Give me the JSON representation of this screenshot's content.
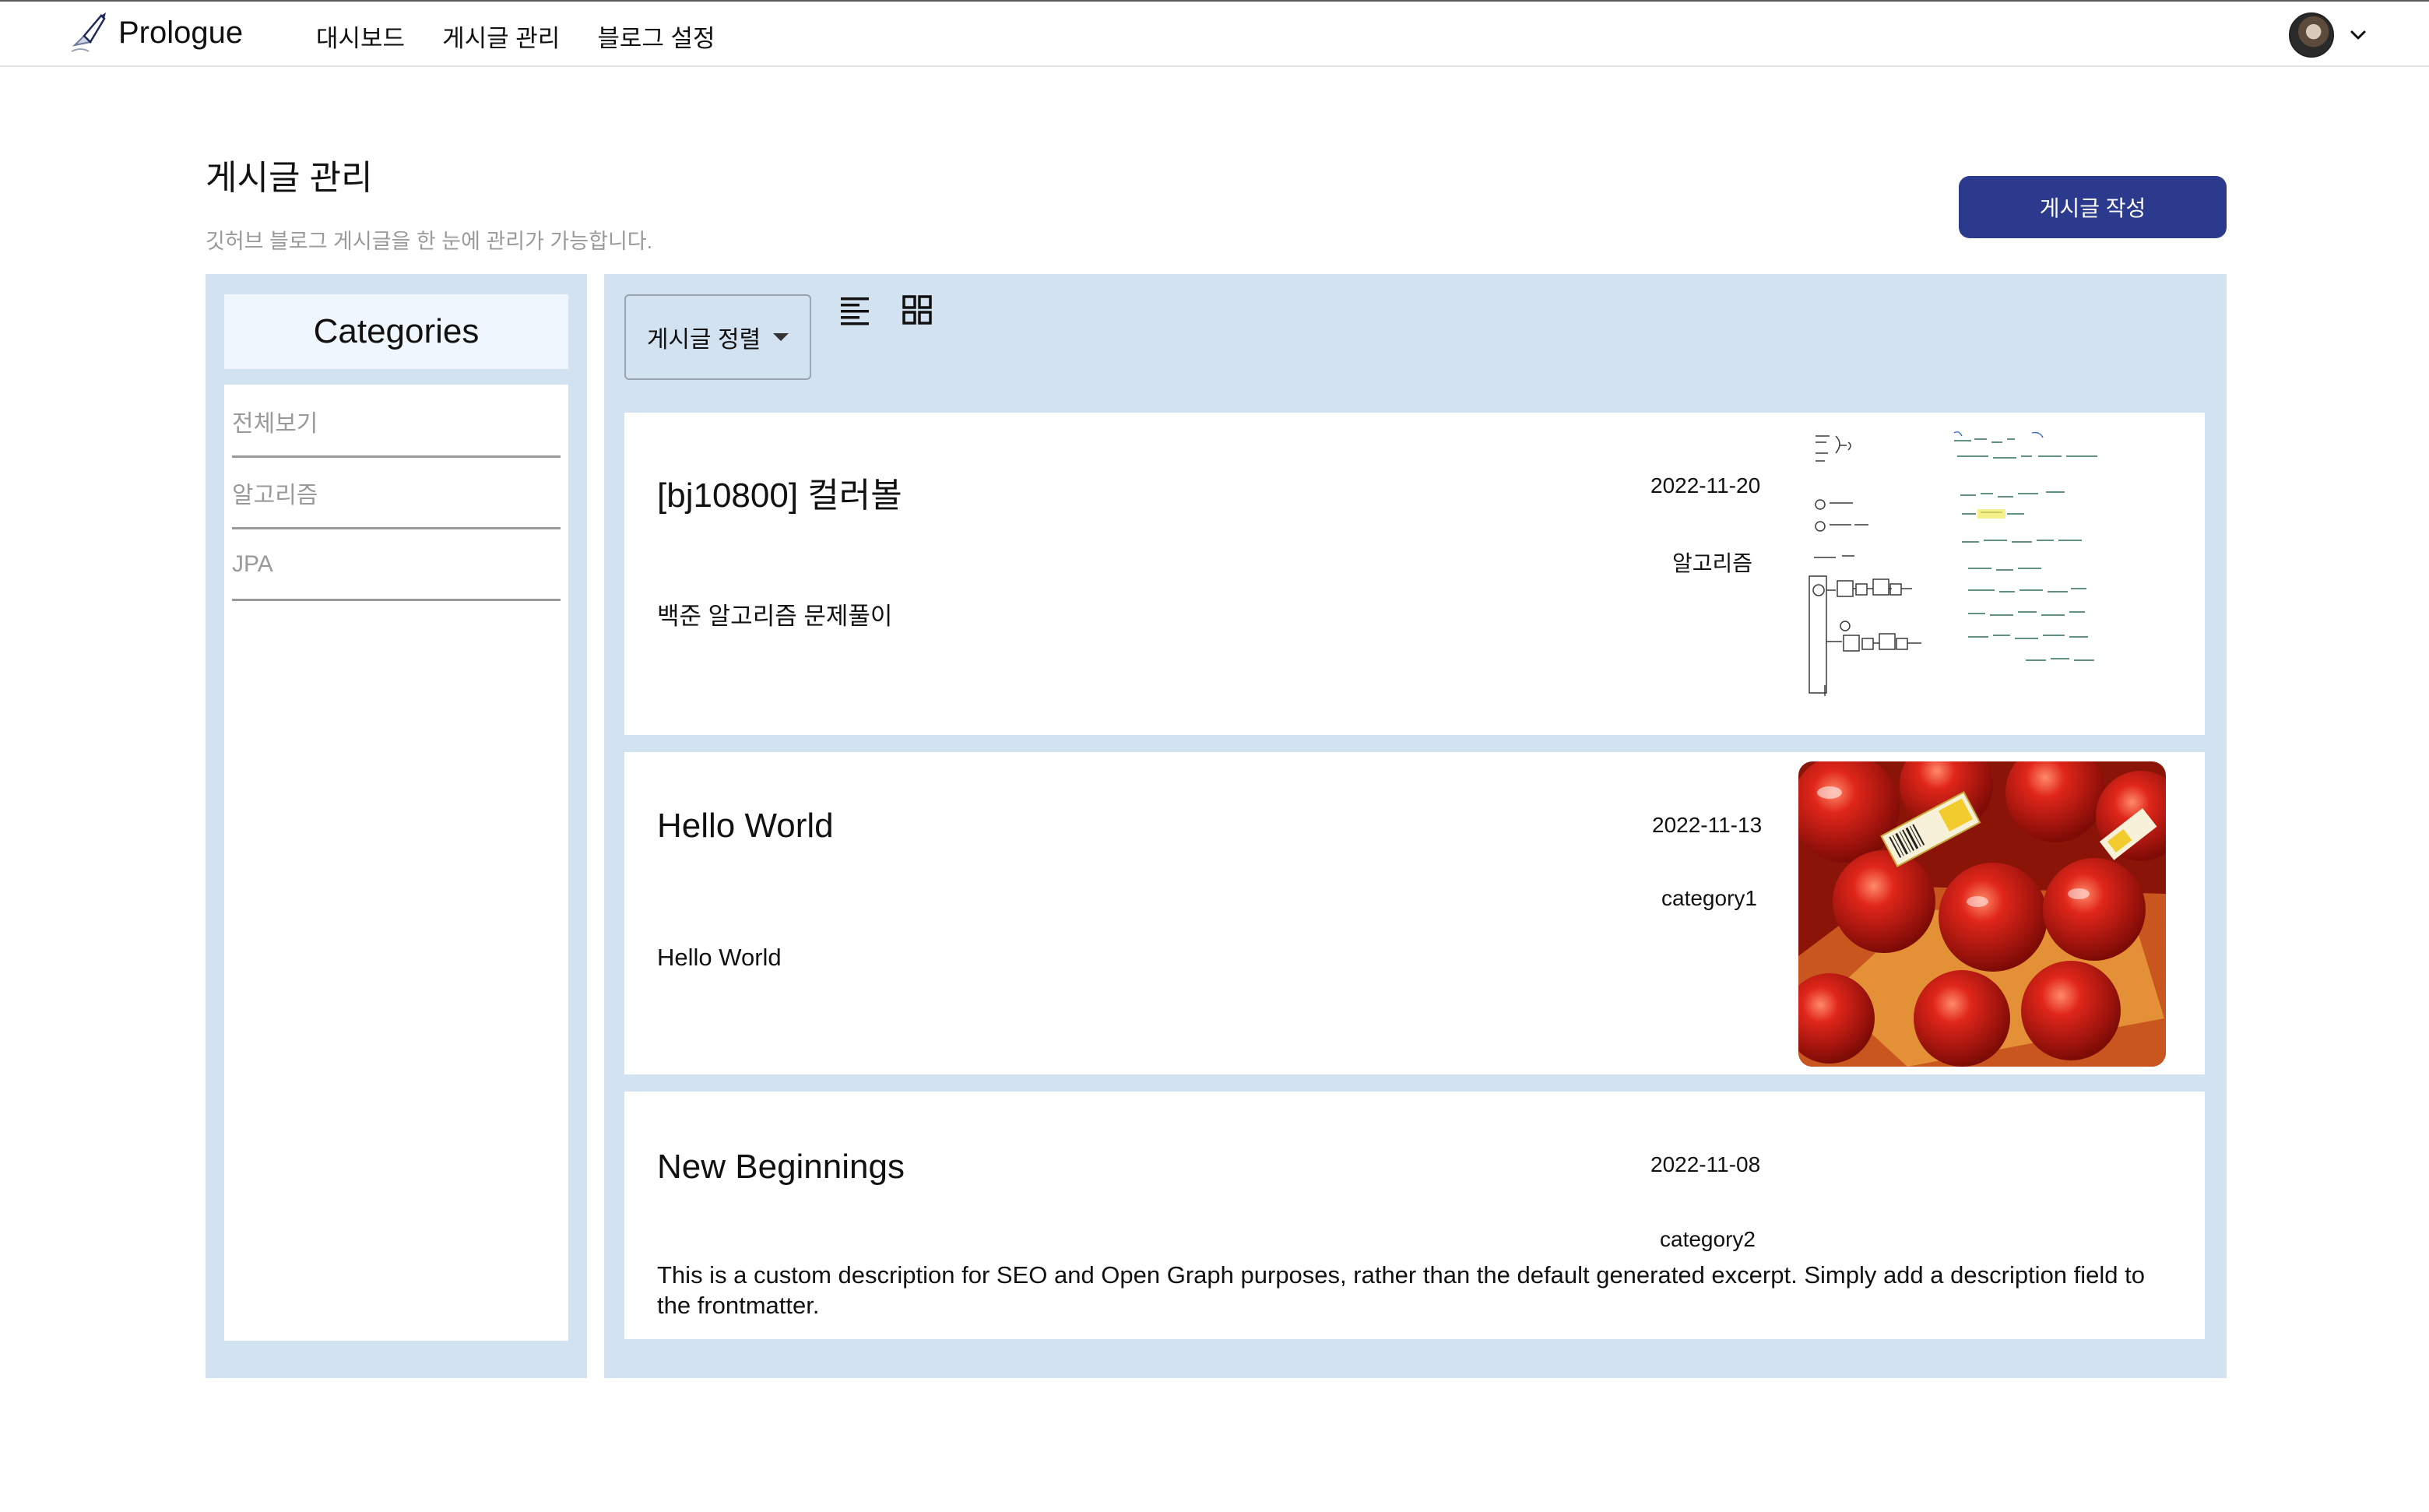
{
  "nav": {
    "brand": "Prologue",
    "items": [
      "대시보드",
      "게시글 관리",
      "블로그 설정"
    ]
  },
  "header": {
    "title": "게시글 관리",
    "subtitle": "깃허브 블로그 게시글을 한 눈에 관리가 가능합니다.",
    "write_button": "게시글 작성"
  },
  "sidebar": {
    "heading": "Categories",
    "items": [
      "전체보기",
      "알고리즘",
      "JPA"
    ]
  },
  "toolbar": {
    "sort_label": "게시글 정렬"
  },
  "posts": [
    {
      "title": "[bj10800] 컬러볼",
      "date": "2022-11-20",
      "category": "알고리즘",
      "description": "백준 알고리즘 문제풀이",
      "thumbnail": "handwritten-notes"
    },
    {
      "title": "Hello World",
      "date": "2022-11-13",
      "category": "category1",
      "description": "Hello World",
      "thumbnail": "red-apples-photo"
    },
    {
      "title": "New Beginnings",
      "date": "2022-11-08",
      "category": "category2",
      "description": "This is a custom description for SEO and Open Graph purposes, rather than the default generated excerpt. Simply add a description field to the frontmatter."
    }
  ],
  "colors": {
    "panel_bg": "#d3e2f0",
    "category_head_bg": "#eff6fe",
    "primary_button": "#2b3a8c"
  }
}
